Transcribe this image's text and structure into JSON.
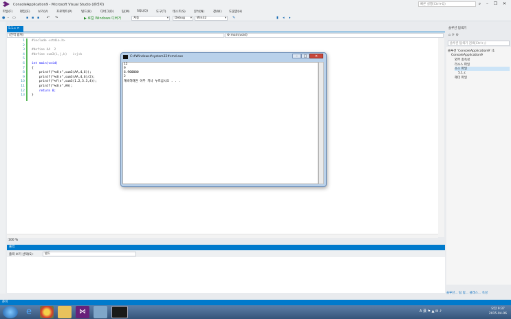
{
  "window": {
    "title": "ConsoleApplication9 - Microsoft Visual Studio (관리자)",
    "quick_launch_placeholder": "빠른 실행(Ctrl+Q)"
  },
  "menu": [
    "파일(F)",
    "편집(E)",
    "보기(V)",
    "프로젝트(P)",
    "빌드(B)",
    "디버그(D)",
    "팀(M)",
    "SQL(Q)",
    "도구(T)",
    "테스트(S)",
    "분석(N)",
    "창(W)",
    "도움말(H)"
  ],
  "toolbar": {
    "run_label": "▶ 로컬 Windows 디버거",
    "auto_label": "자동",
    "config": "Debug",
    "platform": "Win32"
  },
  "editor": {
    "tab_label": "5.1.c",
    "nav_left": "(전역 범위)",
    "nav_right": "main(void)",
    "zoom": "100 %",
    "lines": [
      {
        "n": "1",
        "text": "#include <stdio.h>"
      },
      {
        "n": "2",
        "text": ""
      },
      {
        "n": "3",
        "text": "#define AA  2"
      },
      {
        "n": "4",
        "text": "#define sum3(i,j,k)   i+j+k"
      },
      {
        "n": "5",
        "text": ""
      },
      {
        "n": "6",
        "text": "int main(void)"
      },
      {
        "n": "7",
        "text": "{"
      },
      {
        "n": "8",
        "text": "    printf(\"%d\\n\",sum3(AA,4,6));"
      },
      {
        "n": "9",
        "text": "    printf(\"%d\\n\",sum3(AA,4,6)/2);"
      },
      {
        "n": "10",
        "text": "    printf(\"%f\\n\",sum3(1.2,3.3,4));"
      },
      {
        "n": "11",
        "text": "    printf(\"%d\\n\",AA);"
      },
      {
        "n": "12",
        "text": "    return 0;"
      },
      {
        "n": "13",
        "text": "}"
      }
    ]
  },
  "output": {
    "header": "출력",
    "show_label": "출력 보기 선택(S):",
    "source": "빌드"
  },
  "solution_explorer": {
    "header": "솔루션 탐색기",
    "search_placeholder": "솔루션 탐색기 검색(Ctrl+;)",
    "items": [
      {
        "label": "솔루션 'ConsoleApplication9' (1",
        "indent": 0,
        "selected": false
      },
      {
        "label": "ConsoleApplication9",
        "indent": 1,
        "selected": false
      },
      {
        "label": "외부 종속성",
        "indent": 2,
        "selected": false
      },
      {
        "label": "리소스 파일",
        "indent": 2,
        "selected": false
      },
      {
        "label": "소스 파일",
        "indent": 2,
        "selected": true
      },
      {
        "label": "5.1.c",
        "indent": 3,
        "selected": false
      },
      {
        "label": "헤더 파일",
        "indent": 2,
        "selected": false
      }
    ],
    "tabs": [
      "솔루션...",
      "팀 탐...",
      "클래스...",
      "속성"
    ]
  },
  "status": "준비",
  "console": {
    "title": "C:#Windows#system32#cmd.exe",
    "lines": [
      "12",
      "9",
      "6.900000",
      "2",
      "계속하려면 아무 키나 누르십시오 . . ."
    ]
  },
  "clock": {
    "time": "오전 9:37",
    "date": "2015-04-06"
  },
  "tray_label": "A 漢"
}
